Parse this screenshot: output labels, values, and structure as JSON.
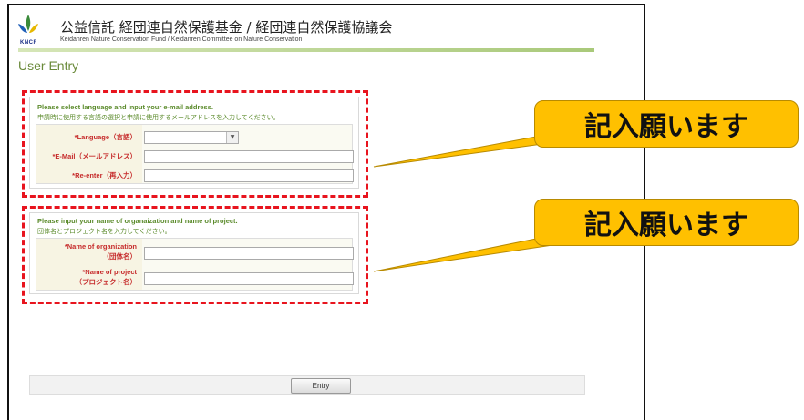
{
  "header": {
    "logo_text": "KNCF",
    "title_ja": "公益信託 経団連自然保護基金 / 経団連自然保護協議会",
    "title_en": "Keidanren Nature Conservation Fund / Keidanren Committee on Nature Conservation"
  },
  "page": {
    "title": "User Entry"
  },
  "section1": {
    "title_en": "Please select language and input your e-mail address.",
    "title_ja": "申請時に使用する言語の選択と申請に使用するメールアドレスを入力してください。",
    "fields": {
      "language": {
        "label": "*Language（言語）",
        "value": ""
      },
      "email": {
        "label": "*E-Mail（メールアドレス）",
        "value": ""
      },
      "reenter": {
        "label": "*Re-enter（再入力）",
        "value": ""
      }
    }
  },
  "section2": {
    "title_en": "Please input your name of organaization and name of project.",
    "title_ja": "団体名とプロジェクト名を入力してください。",
    "fields": {
      "organization": {
        "label_line1": "*Name of organization",
        "label_line2": "（団体名）",
        "value": ""
      },
      "project": {
        "label_line1": "*Name of project",
        "label_line2": "（プロジェクト名）",
        "value": ""
      }
    }
  },
  "callouts": {
    "top": "記入願います",
    "bottom": "記入願います"
  },
  "footer": {
    "entry_label": "Entry"
  },
  "colors": {
    "accent_green": "#6a8a3a",
    "required_red": "#c62b2b",
    "highlight_red": "#e8141e",
    "callout_yellow": "#ffc000"
  }
}
